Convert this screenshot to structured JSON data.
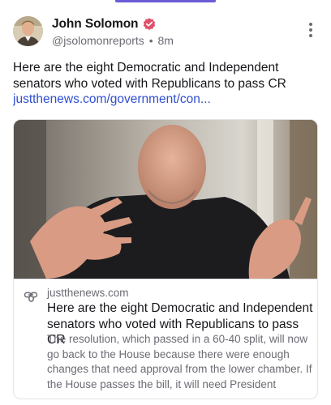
{
  "author": {
    "name": "John Solomon",
    "handle": "@jsolomonreports",
    "separator": "•",
    "time": "8m",
    "avatar_icon": "person-avatar",
    "verified_icon": "verified-badge-icon",
    "verified_color": "#e0506a"
  },
  "post": {
    "text": "Here are the eight Democratic and Independent senators who voted with Republicans to pass CR",
    "link_text": "justthenews.com/government/con..."
  },
  "card": {
    "domain": "justthenews.com",
    "title": "Here are the eight Democratic and Independent senators who voted with Republicans to pass CR",
    "description": "The resolution, which passed in a 60-40 split, will now go back to the House because there were enough changes that need approval from the lower chamber. If the House passes the bill, it will need President Donal...",
    "image_icon": "news-photo",
    "link_icon": "link-icon"
  },
  "colors": {
    "accent": "#6a5cd6",
    "link": "#2f4fd0",
    "text": "#16161a",
    "muted": "#6b6b74"
  }
}
